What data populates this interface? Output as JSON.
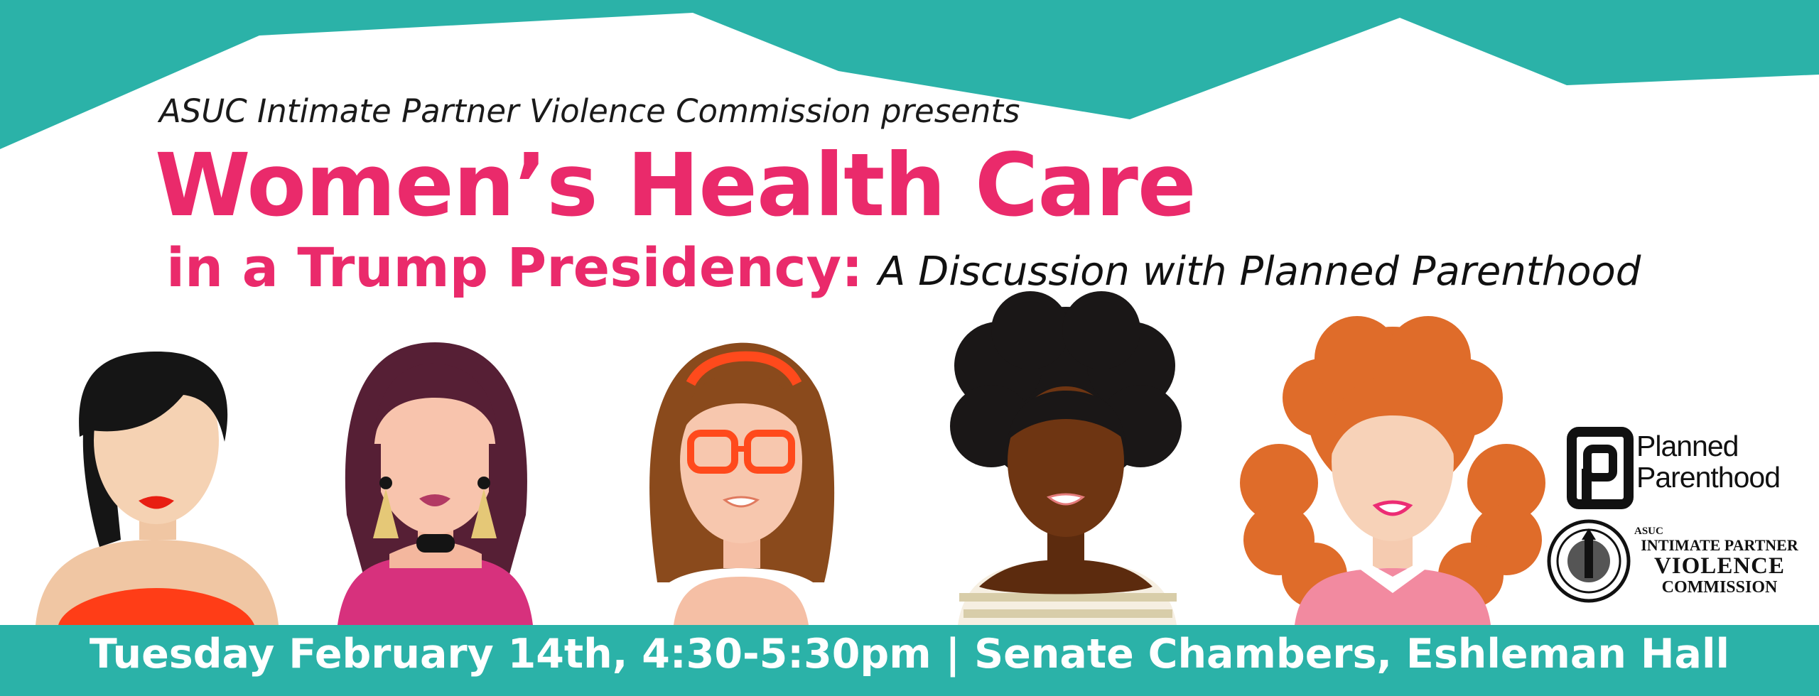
{
  "banner": {
    "presents": "ASUC Intimate Partner Violence Commission presents",
    "title_line1": "Women’s Health Care",
    "title_line2": "in a Trump Presidency:",
    "subtitle": "A Discussion with Planned Parenthood",
    "event_details": "Tuesday February 14th, 4:30-5:30pm | Senate Chambers, Eshleman Hall"
  },
  "logos": {
    "planned_parenthood": {
      "line1": "Planned",
      "line2": "Parenthood"
    },
    "ipv_commission": {
      "line1": "ASUC",
      "line2": "INTIMATE PARTNER",
      "line3": "VIOLENCE",
      "line4": "COMMISSION"
    }
  },
  "colors": {
    "teal": "#2bb2a8",
    "pink": "#ea2a6b"
  },
  "illustration": [
    "woman-black-hair",
    "woman-burgundy-hair",
    "woman-glasses",
    "woman-curly-hair",
    "woman-red-hair"
  ]
}
